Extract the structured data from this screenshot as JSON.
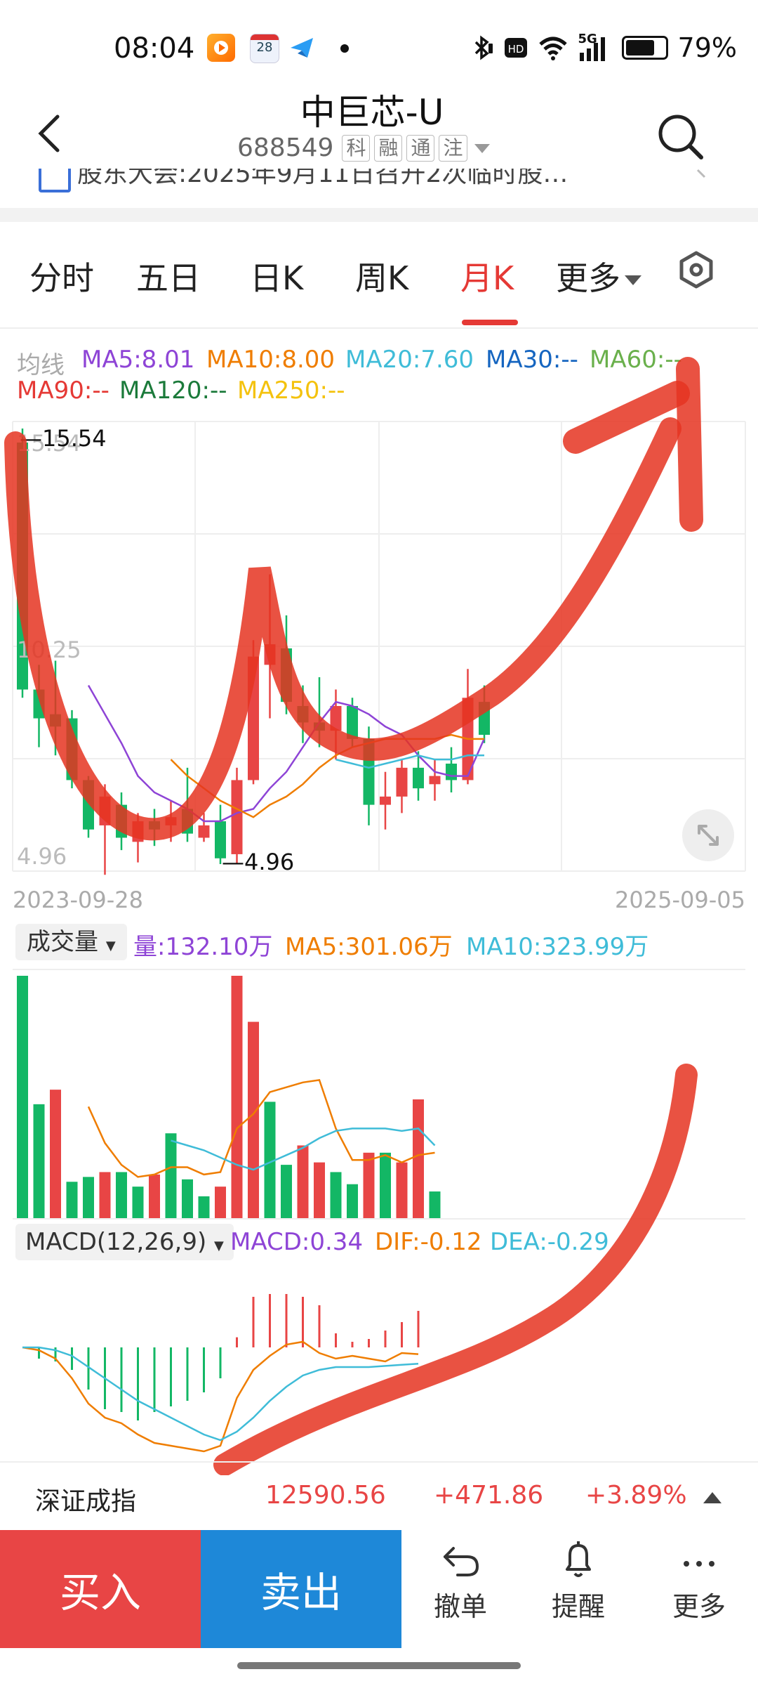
{
  "status_bar": {
    "time": "08:04",
    "calendar_day": "28",
    "network": "5G",
    "battery": "79%",
    "battery_level": 0.79
  },
  "header": {
    "title": "中巨芯-U",
    "code": "688549",
    "tags": [
      "科",
      "融",
      "通",
      "注"
    ]
  },
  "news": {
    "text": "股东大会:2025年9月11日召开2次临时股…"
  },
  "tabs": [
    "分时",
    "五日",
    "日K",
    "周K",
    "月K",
    "更多"
  ],
  "active_tab": "月K",
  "ma_legend": {
    "label": "均线",
    "items": [
      {
        "text": "MA5:8.01",
        "color": "#8e44d6"
      },
      {
        "text": "MA10:8.00",
        "color": "#ef7d00"
      },
      {
        "text": "MA20:7.60",
        "color": "#3fbcd8"
      },
      {
        "text": "MA30:--",
        "color": "#1565c0"
      },
      {
        "text": "MA60:--",
        "color": "#6ab04c"
      },
      {
        "text": "MA90:--",
        "color": "#e53935"
      },
      {
        "text": "MA120:--",
        "color": "#1b7a3a"
      },
      {
        "text": "MA250:--",
        "color": "#f4c20d"
      }
    ]
  },
  "chart_data": {
    "type": "candlestick",
    "period": "monthly",
    "y_top_label": "15.54",
    "y_mid_label": "10.25",
    "y_bottom_label": "4.96",
    "high_marker": "15.54",
    "low_marker": "4.96",
    "ylim": [
      4.96,
      15.54
    ],
    "start_date": "2023-09-28",
    "end_date": "2025-09-05",
    "candles": [
      {
        "o": 15.2,
        "c": 9.2,
        "h": 15.54,
        "l": 9.0
      },
      {
        "o": 9.2,
        "c": 8.5,
        "h": 9.8,
        "l": 7.8
      },
      {
        "o": 8.6,
        "c": 8.3,
        "h": 9.9,
        "l": 7.6
      },
      {
        "o": 8.5,
        "c": 7.0,
        "h": 8.7,
        "l": 6.8
      },
      {
        "o": 7.0,
        "c": 5.8,
        "h": 7.1,
        "l": 5.6
      },
      {
        "o": 5.9,
        "c": 6.6,
        "h": 6.9,
        "l": 4.7
      },
      {
        "o": 6.4,
        "c": 5.6,
        "h": 6.7,
        "l": 5.3
      },
      {
        "o": 5.5,
        "c": 6.0,
        "h": 6.2,
        "l": 5.0
      },
      {
        "o": 6.0,
        "c": 5.8,
        "h": 6.3,
        "l": 5.4
      },
      {
        "o": 5.9,
        "c": 6.1,
        "h": 6.5,
        "l": 5.5
      },
      {
        "o": 6.3,
        "c": 5.7,
        "h": 7.3,
        "l": 5.5
      },
      {
        "o": 5.6,
        "c": 5.9,
        "h": 6.2,
        "l": 5.5
      },
      {
        "o": 6.0,
        "c": 5.1,
        "h": 6.4,
        "l": 4.96
      },
      {
        "o": 5.2,
        "c": 7.0,
        "h": 7.3,
        "l": 4.96
      },
      {
        "o": 7.0,
        "c": 10.0,
        "h": 10.4,
        "l": 6.9
      },
      {
        "o": 9.8,
        "c": 10.3,
        "h": 12.0,
        "l": 8.5
      },
      {
        "o": 10.2,
        "c": 8.9,
        "h": 11.0,
        "l": 8.6
      },
      {
        "o": 8.8,
        "c": 8.4,
        "h": 9.3,
        "l": 7.9
      },
      {
        "o": 8.4,
        "c": 8.2,
        "h": 9.5,
        "l": 7.8
      },
      {
        "o": 8.2,
        "c": 8.8,
        "h": 9.2,
        "l": 7.5
      },
      {
        "o": 8.8,
        "c": 8.0,
        "h": 9.0,
        "l": 7.8
      },
      {
        "o": 8.0,
        "c": 6.4,
        "h": 8.3,
        "l": 5.9
      },
      {
        "o": 6.4,
        "c": 6.6,
        "h": 7.2,
        "l": 5.8
      },
      {
        "o": 6.6,
        "c": 7.3,
        "h": 7.5,
        "l": 6.2
      },
      {
        "o": 7.3,
        "c": 6.8,
        "h": 7.7,
        "l": 6.5
      },
      {
        "o": 6.9,
        "c": 7.1,
        "h": 7.5,
        "l": 6.5
      },
      {
        "o": 7.4,
        "c": 7.0,
        "h": 7.8,
        "l": 6.7
      },
      {
        "o": 7.0,
        "c": 9.0,
        "h": 9.7,
        "l": 6.9
      },
      {
        "o": 8.9,
        "c": 8.1,
        "h": 9.3,
        "l": 7.9
      }
    ],
    "ma5": [
      null,
      null,
      null,
      null,
      9.3,
      8.6,
      7.9,
      7.1,
      6.7,
      6.5,
      6.3,
      6.0,
      6.0,
      6.2,
      6.3,
      6.8,
      7.2,
      7.8,
      8.4,
      8.9,
      8.8,
      8.6,
      8.3,
      8.1,
      7.6,
      7.2,
      7.1,
      7.1,
      8.01
    ],
    "ma10": [
      null,
      null,
      null,
      null,
      null,
      null,
      null,
      null,
      null,
      7.5,
      7.1,
      6.8,
      6.5,
      6.3,
      6.1,
      6.4,
      6.6,
      6.9,
      7.3,
      7.6,
      7.8,
      7.9,
      8.0,
      8.0,
      8.0,
      8.0,
      8.1,
      8.0,
      8.0
    ],
    "ma20": [
      null,
      null,
      null,
      null,
      null,
      null,
      null,
      null,
      null,
      null,
      null,
      null,
      null,
      null,
      null,
      null,
      null,
      null,
      null,
      7.5,
      7.4,
      7.3,
      7.4,
      7.5,
      7.6,
      7.5,
      7.5,
      7.6,
      7.6
    ]
  },
  "volume": {
    "selector": "成交量",
    "legend": [
      {
        "text": "量:132.10万",
        "color": "#8e44d6"
      },
      {
        "text": "MA5:301.06万",
        "color": "#ef7d00"
      },
      {
        "text": "MA10:323.99万",
        "color": "#3fbcd8"
      }
    ],
    "bars": [
      {
        "v": 1000,
        "up": false
      },
      {
        "v": 470,
        "up": false
      },
      {
        "v": 530,
        "up": true
      },
      {
        "v": 150,
        "up": false
      },
      {
        "v": 170,
        "up": false
      },
      {
        "v": 190,
        "up": true
      },
      {
        "v": 190,
        "up": false
      },
      {
        "v": 130,
        "up": false
      },
      {
        "v": 180,
        "up": true
      },
      {
        "v": 350,
        "up": false
      },
      {
        "v": 160,
        "up": false
      },
      {
        "v": 90,
        "up": false
      },
      {
        "v": 130,
        "up": true
      },
      {
        "v": 1000,
        "up": true
      },
      {
        "v": 810,
        "up": true
      },
      {
        "v": 480,
        "up": false
      },
      {
        "v": 220,
        "up": false
      },
      {
        "v": 300,
        "up": true
      },
      {
        "v": 230,
        "up": true
      },
      {
        "v": 190,
        "up": false
      },
      {
        "v": 140,
        "up": false
      },
      {
        "v": 270,
        "up": true
      },
      {
        "v": 270,
        "up": false
      },
      {
        "v": 230,
        "up": true
      },
      {
        "v": 490,
        "up": true
      },
      {
        "v": 110,
        "up": false
      }
    ],
    "ma5": [
      null,
      null,
      null,
      null,
      460,
      310,
      220,
      170,
      180,
      210,
      210,
      180,
      190,
      370,
      430,
      520,
      540,
      560,
      570,
      370,
      240,
      240,
      260,
      230,
      260,
      270
    ],
    "ma10": [
      null,
      null,
      null,
      null,
      null,
      null,
      null,
      null,
      null,
      320,
      300,
      280,
      250,
      220,
      200,
      230,
      260,
      290,
      330,
      360,
      370,
      370,
      370,
      360,
      370,
      300
    ]
  },
  "macd": {
    "selector": "MACD(12,26,9)",
    "legend": [
      {
        "text": "MACD:0.34",
        "color": "#8e44d6"
      },
      {
        "text": "DIF:-0.12",
        "color": "#ef7d00"
      },
      {
        "text": "DEA:-0.29",
        "color": "#3fbcd8"
      }
    ],
    "hist": [
      0,
      -0.2,
      -0.25,
      -0.4,
      -0.75,
      -1.1,
      -1.15,
      -1.3,
      -1.15,
      -1.05,
      -0.95,
      -0.8,
      -0.55,
      0.18,
      0.9,
      0.95,
      0.95,
      0.9,
      0.75,
      0.25,
      0.1,
      0.15,
      0.3,
      0.45,
      0.65
    ],
    "dif": [
      0,
      -0.05,
      -0.2,
      -0.55,
      -1.0,
      -1.25,
      -1.35,
      -1.55,
      -1.7,
      -1.75,
      -1.8,
      -1.85,
      -1.75,
      -0.9,
      -0.4,
      -0.15,
      0.05,
      0.1,
      -0.1,
      -0.2,
      -0.15,
      -0.2,
      -0.25,
      -0.1,
      -0.12
    ],
    "dea": [
      0,
      0,
      -0.05,
      -0.15,
      -0.35,
      -0.55,
      -0.75,
      -0.95,
      -1.1,
      -1.25,
      -1.4,
      -1.55,
      -1.65,
      -1.5,
      -1.25,
      -0.95,
      -0.7,
      -0.5,
      -0.4,
      -0.35,
      -0.35,
      -0.35,
      -0.33,
      -0.31,
      -0.29
    ]
  },
  "index_bar": {
    "name": "深证成指",
    "value": "12590.56",
    "change": "+471.86",
    "pct": "+3.89%"
  },
  "bottom": {
    "buy": "买入",
    "sell": "卖出",
    "actions": [
      "撤单",
      "提醒",
      "更多"
    ]
  },
  "colors": {
    "up": "#e84545",
    "down": "#13b765",
    "buy": "#e84545",
    "sell": "#1e88d8",
    "annotation": "#e53421"
  }
}
